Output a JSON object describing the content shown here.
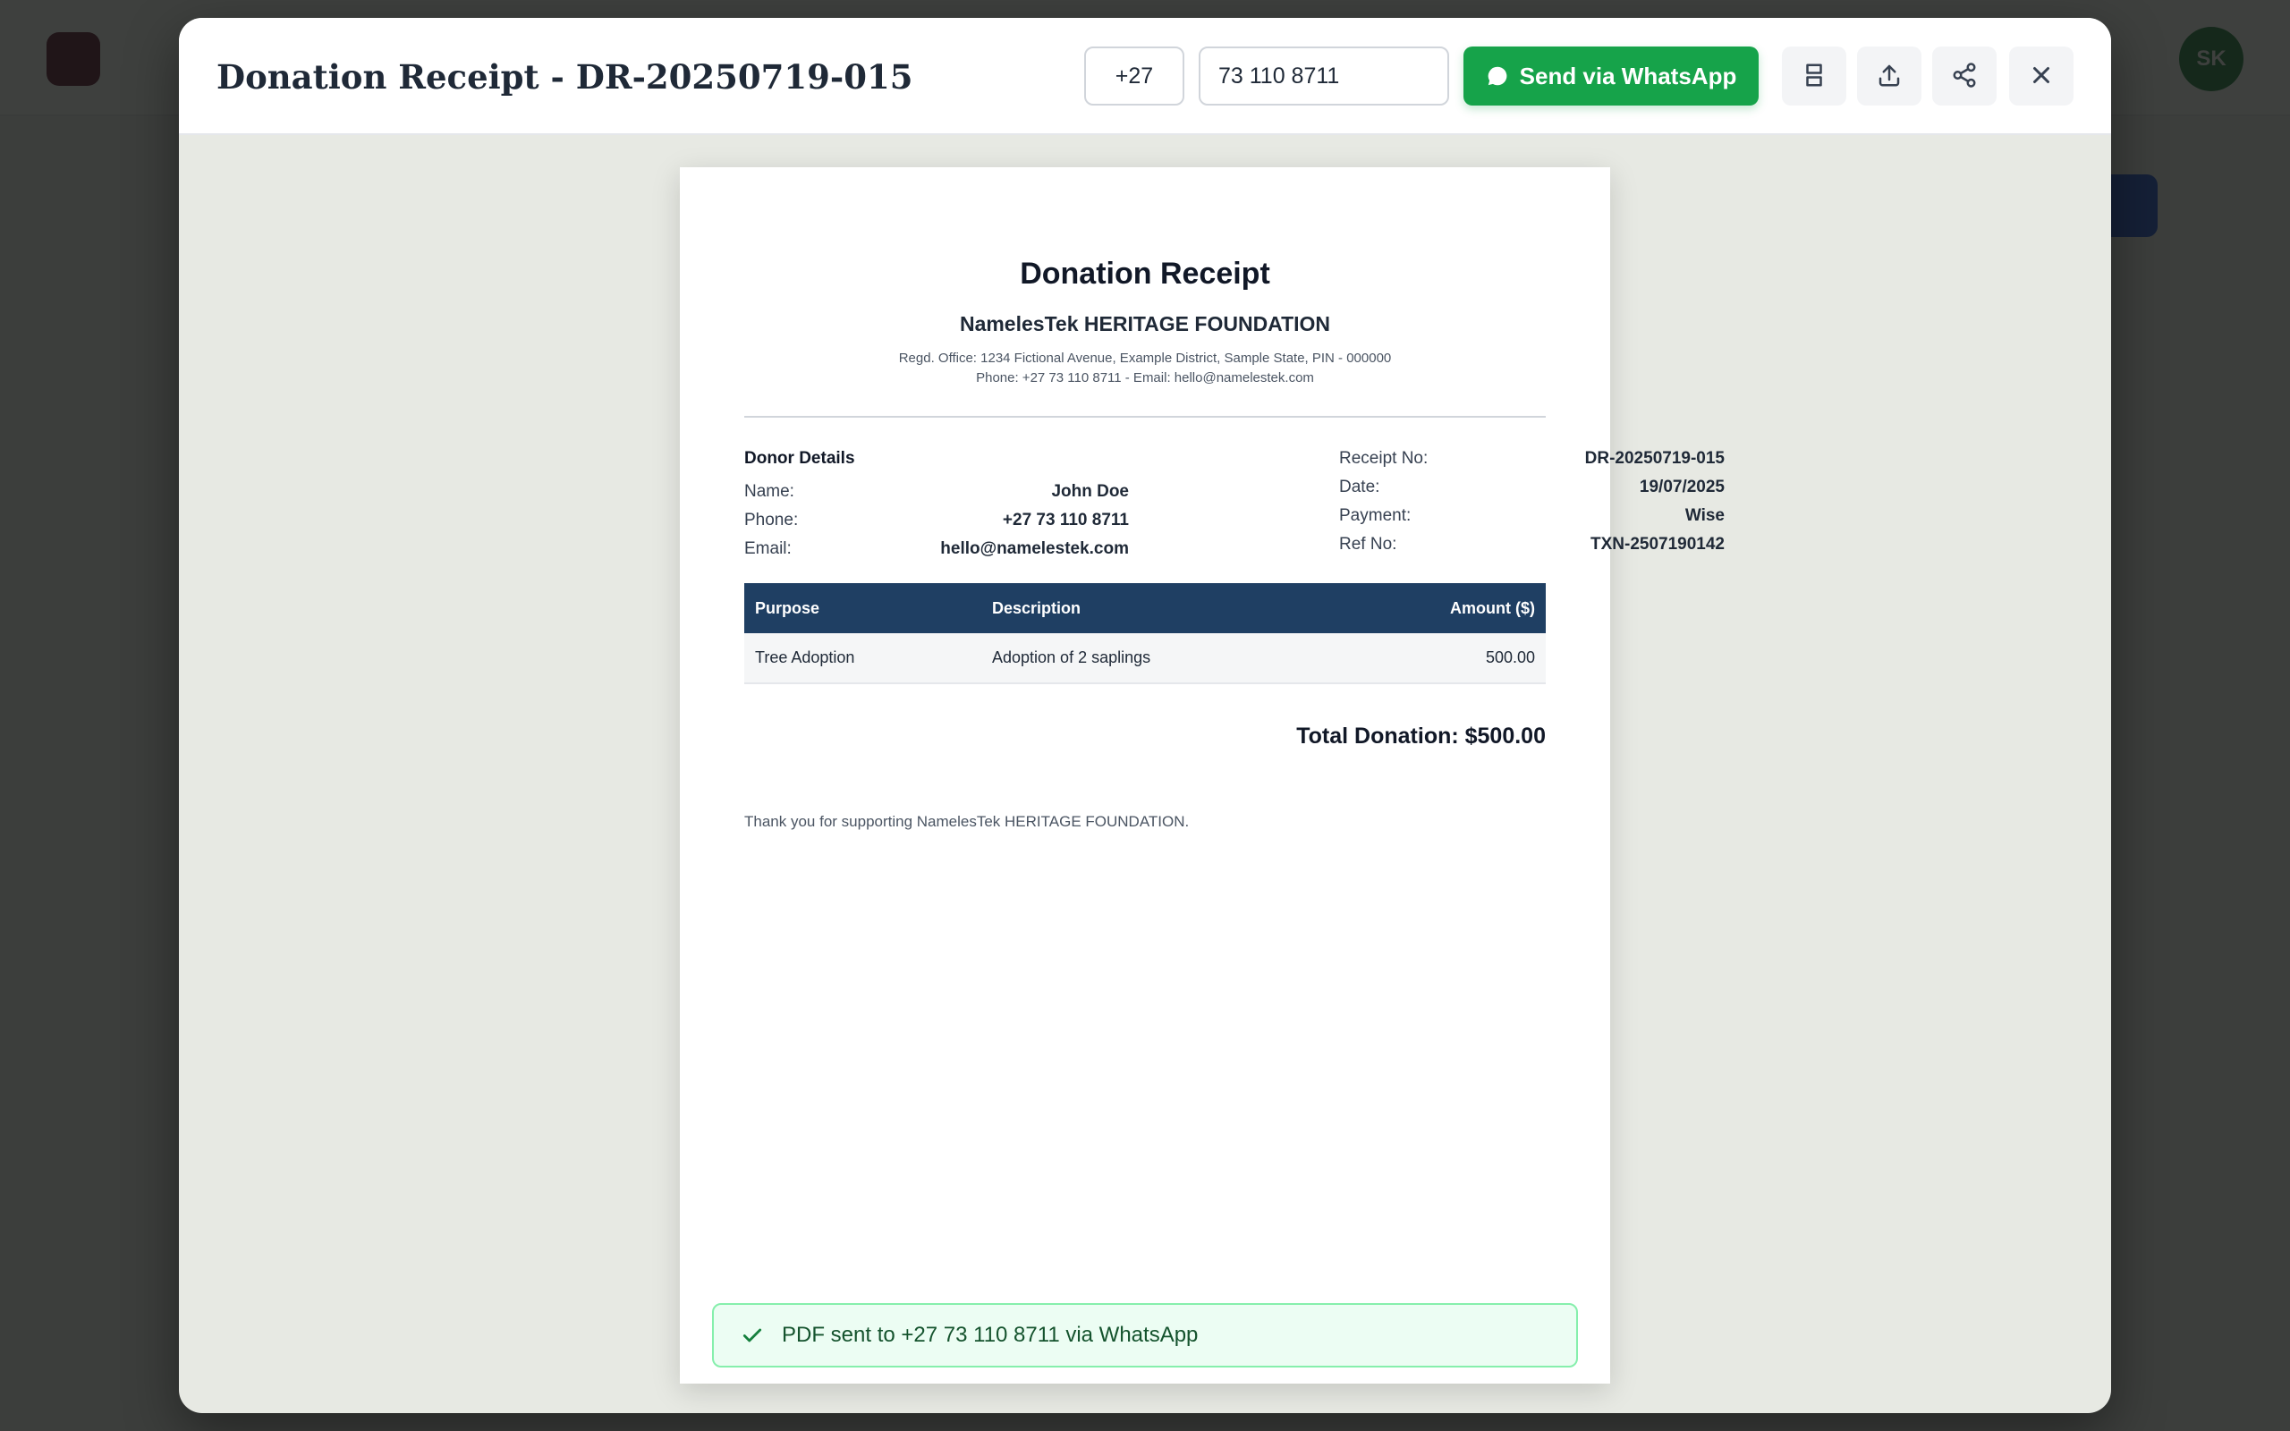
{
  "background": {
    "avatar_initials": "SK"
  },
  "modal": {
    "title": "Donation Receipt - DR-20250719-015",
    "country_code": "+27",
    "phone_number": "73 110 8711",
    "send_button_label": "Send via WhatsApp",
    "icons": [
      "whatsapp-icon",
      "fit-page-icon",
      "upload-icon",
      "share-icon",
      "close-icon"
    ],
    "accent_color": "#16a34a"
  },
  "receipt": {
    "title": "Donation Receipt",
    "org_name": "NamelesTek HERITAGE FOUNDATION",
    "org_address": "Regd. Office: 1234 Fictional Avenue, Example District, Sample State, PIN - 000000",
    "org_contact": "Phone: +27 73 110 8711 - Email: hello@namelestek.com",
    "donor_heading": "Donor Details",
    "donor": [
      {
        "label": "Name:",
        "value": "John Doe"
      },
      {
        "label": "Phone:",
        "value": "+27 73 110 8711"
      },
      {
        "label": "Email:",
        "value": "hello@namelestek.com"
      }
    ],
    "meta": [
      {
        "label": "Receipt No:",
        "value": "DR-20250719-015"
      },
      {
        "label": "Date:",
        "value": "19/07/2025"
      },
      {
        "label": "Payment:",
        "value": "Wise"
      },
      {
        "label": "Ref No:",
        "value": "TXN-2507190142"
      }
    ],
    "table": {
      "headers": [
        "Purpose",
        "Description",
        "Amount ($)"
      ],
      "rows": [
        [
          "Tree Adoption",
          "Adoption of 2 saplings",
          "500.00"
        ]
      ],
      "header_color": "#1f3f63"
    },
    "total": "Total Donation: $500.00",
    "thanks": "Thank you for supporting NamelesTek HERITAGE FOUNDATION."
  },
  "toast": {
    "message": "PDF sent to +27 73 110 8711 via WhatsApp",
    "icon": "checkmark-icon"
  }
}
